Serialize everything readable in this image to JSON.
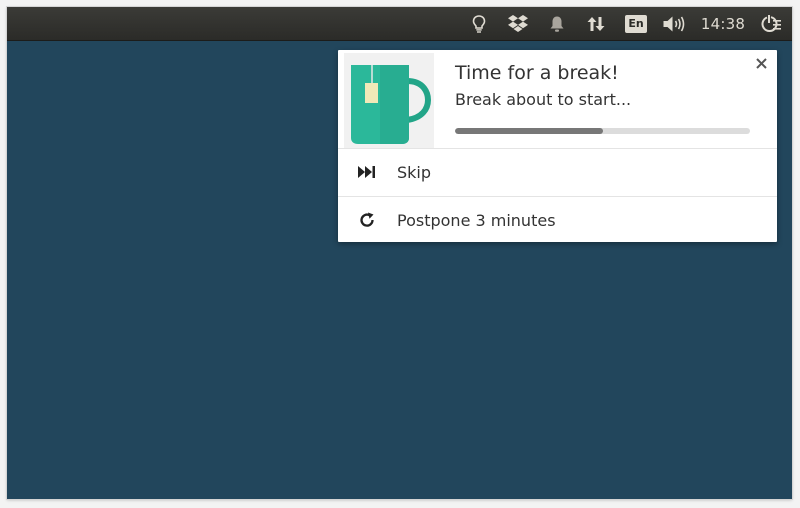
{
  "topbar": {
    "clock": "14:38",
    "keyboard_layout": "En",
    "icons": [
      "lightbulb-icon",
      "dropbox-icon",
      "bell-icon",
      "network-arrows-icon",
      "keyboard-layout-indicator",
      "volume-icon",
      "session-menu-icon"
    ]
  },
  "notification": {
    "title": "Time for a break!",
    "message": "Break about to start...",
    "progress_fraction": 0.5,
    "icon": "tea-mug-icon",
    "close_icon": "close-icon",
    "actions": [
      {
        "label": "Skip",
        "icon": "skip-forward-icon"
      },
      {
        "label": "Postpone 3 minutes",
        "icon": "refresh-icon"
      }
    ]
  },
  "colors": {
    "desktop": "#22465c",
    "panel": "#2f2f2c",
    "mug": "#2bb89a",
    "progress_fill": "#777777",
    "progress_track": "#dcdcdc"
  }
}
